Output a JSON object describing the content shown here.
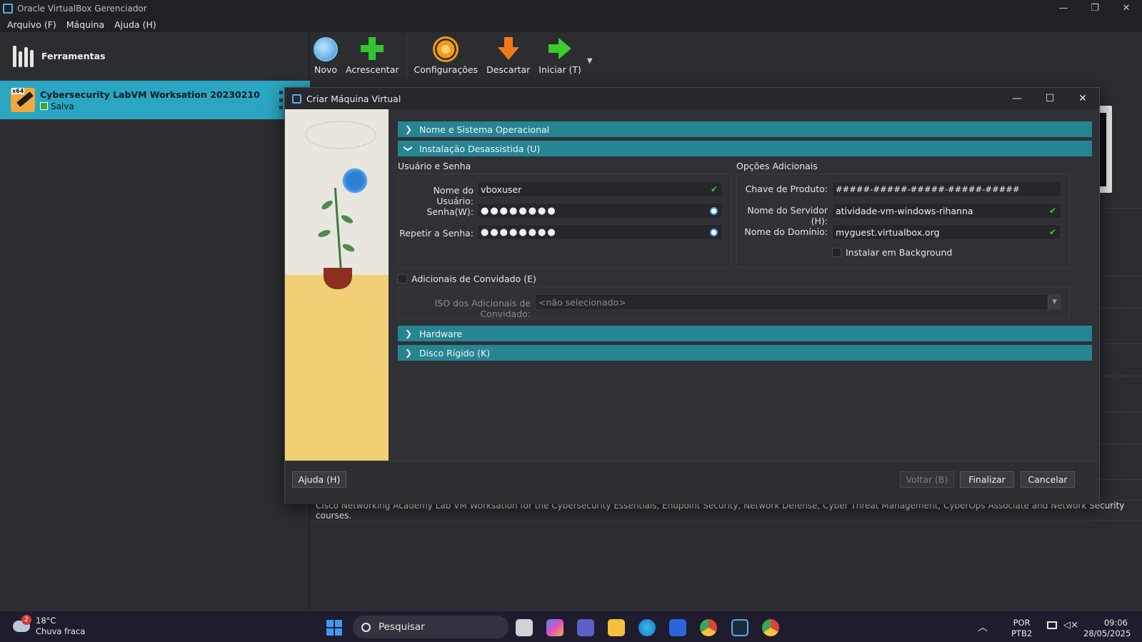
{
  "window": {
    "title": "Oracle VirtualBox Gerenciador",
    "controls": {
      "minimize": "—",
      "restore": "❐",
      "close": "✕"
    }
  },
  "menu": [
    {
      "label": "Arquivo (F)"
    },
    {
      "label": "Máquina"
    },
    {
      "label": "Ajuda (H)"
    }
  ],
  "sidebar": {
    "tools_label": "Ferramentas",
    "vm": {
      "name": "Cybersecurity LabVM Worksation 20230210",
      "state": "Salva",
      "os_badge": "x64"
    }
  },
  "toolbar": {
    "new": "Novo",
    "add": "Acrescentar",
    "settings": "Configurações",
    "discard": "Descartar",
    "start": "Iniciar (T)"
  },
  "description": "Cisco Networking Academy Lab VM Worksation for the Cybersecurity Essentials, Endpoint Security, Network Defense, Cyber Threat Management, CyberOps Associate and Network Security courses.",
  "dialog": {
    "title": "Criar Máquina Virtual",
    "controls": {
      "minimize": "—",
      "maximize": "☐",
      "close": "✕"
    },
    "sections": {
      "name_os": "Nome e Sistema Operacional",
      "unattended": "Instalação Desassistida (U)",
      "hardware": "Hardware",
      "disk": "Disco Rígido (K)"
    },
    "user_group": {
      "title": "Usuário e Senha",
      "username_label": "Nome do Usuário:",
      "username_value": "vboxuser",
      "password_label": "Senha(W):",
      "password_value": "●●●●●●●●",
      "repeat_label": "Repetir a Senha:",
      "repeat_value": "●●●●●●●●"
    },
    "options_group": {
      "title": "Opções Adicionais",
      "product_key_label": "Chave de Produto:",
      "product_key_value": "#####-#####-#####-#####-#####",
      "hostname_label": "Nome do Servidor (H):",
      "hostname_value": "atividade-vm-windows-rihanna",
      "domain_label": "Nome do Domínio:",
      "domain_value": "myguest.virtualbox.org",
      "background_label": "Instalar em Background"
    },
    "guest_additions": {
      "label": "Adicionais de Convidado (E)",
      "iso_label": "ISO dos Adicionais de Convidado:",
      "iso_value": "<não selecionado>"
    },
    "buttons": {
      "help": "Ajuda (H)",
      "back": "Voltar (B)",
      "finish": "Finalizar",
      "cancel": "Cancelar"
    }
  },
  "taskbar": {
    "weather_badge": "2",
    "temperature": "18°C",
    "weather": "Chuva fraca",
    "search_placeholder": "Pesquisar",
    "lang": "POR",
    "layout": "PTB2",
    "time": "09:06",
    "date": "28/05/2025"
  },
  "colors": {
    "accent": "#268593",
    "selection": "#2ba6c2",
    "check": "#35d42d"
  }
}
